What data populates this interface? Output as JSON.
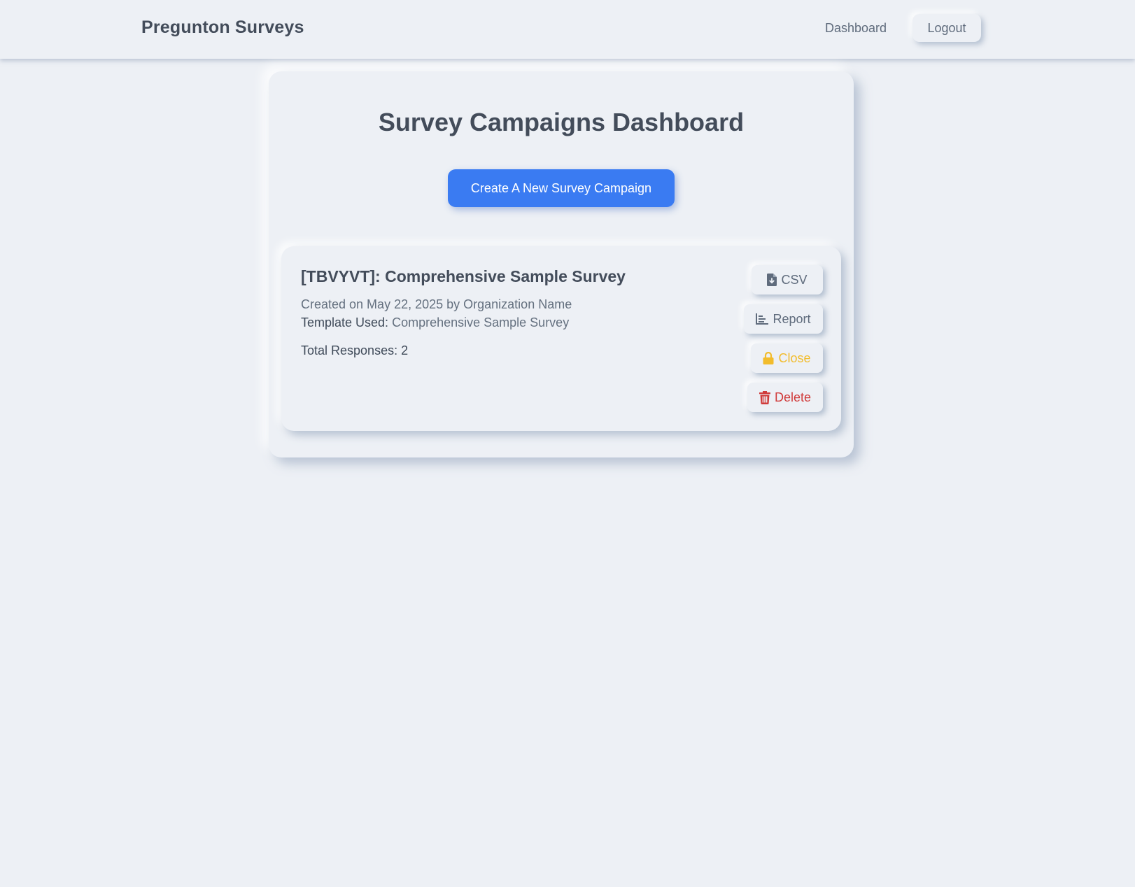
{
  "header": {
    "brand": "Pregunton Surveys",
    "nav_dashboard": "Dashboard",
    "logout_label": "Logout"
  },
  "main": {
    "title": "Survey Campaigns Dashboard",
    "create_label": "Create A New Survey Campaign"
  },
  "campaign": {
    "title": "[TBVYVT]: Comprehensive Sample Survey",
    "created": "Created on May 22, 2025 by Organization Name",
    "template_label": "Template Used:",
    "template_value": "Comprehensive Sample Survey",
    "responses": "Total Responses: 2",
    "actions": {
      "csv": "CSV",
      "report": "Report",
      "close": "Close",
      "delete": "Delete"
    }
  },
  "icons": {
    "csv": "file-download-icon",
    "report": "bar-chart-icon",
    "close": "lock-icon",
    "delete": "trash-icon"
  },
  "colors": {
    "background": "#edf0f5",
    "primary": "#3a7bf2",
    "warning": "#f2bc2c",
    "danger": "#d03b3b",
    "text": "#434c5a",
    "muted": "#64707f"
  }
}
